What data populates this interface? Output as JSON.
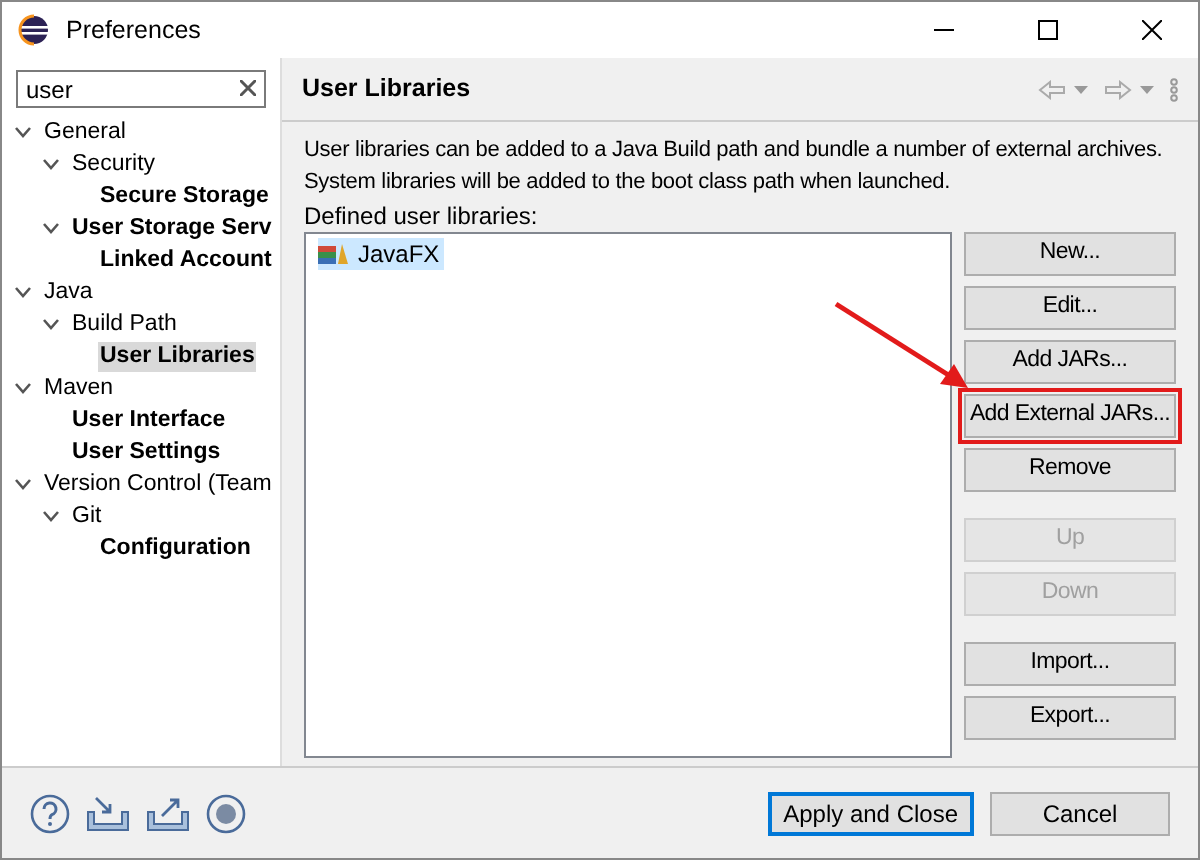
{
  "window": {
    "title": "Preferences"
  },
  "filter": {
    "value": "user"
  },
  "tree": [
    {
      "label": "General",
      "match": false,
      "expanded": true,
      "selected": false,
      "children": [
        {
          "label": "Security",
          "match": false,
          "expanded": true,
          "selected": false,
          "children": [
            {
              "label": "Secure Storage",
              "match": true,
              "selected": false
            }
          ]
        },
        {
          "label": "User Storage Serv",
          "match": true,
          "expanded": true,
          "selected": false,
          "children": [
            {
              "label": "Linked Account",
              "match": true,
              "selected": false
            }
          ]
        }
      ]
    },
    {
      "label": "Java",
      "match": false,
      "expanded": true,
      "selected": false,
      "children": [
        {
          "label": "Build Path",
          "match": false,
          "expanded": true,
          "selected": false,
          "children": [
            {
              "label": "User Libraries",
              "match": true,
              "selected": true
            }
          ]
        }
      ]
    },
    {
      "label": "Maven",
      "match": false,
      "expanded": true,
      "selected": false,
      "children": [
        {
          "label": "User Interface",
          "match": true,
          "selected": false
        },
        {
          "label": "User Settings",
          "match": true,
          "selected": false
        }
      ]
    },
    {
      "label": "Version Control (Team",
      "match": false,
      "expanded": true,
      "selected": false,
      "children": [
        {
          "label": "Git",
          "match": false,
          "expanded": true,
          "selected": false,
          "children": [
            {
              "label": "Configuration",
              "match": true,
              "selected": false
            }
          ]
        }
      ]
    }
  ],
  "page": {
    "title": "User Libraries",
    "description": [
      "User libraries can be added to a Java Build path and bundle a number of external archives.",
      "System libraries will be added to the boot class path when launched."
    ],
    "list_label": "Defined user libraries:",
    "libraries": [
      {
        "label": "JavaFX",
        "selected": true
      }
    ],
    "button_groups": [
      [
        {
          "label": "New...",
          "disabled": false,
          "highlighted": false
        },
        {
          "label": "Edit...",
          "disabled": false,
          "highlighted": false
        },
        {
          "label": "Add JARs...",
          "disabled": false,
          "highlighted": false
        },
        {
          "label": "Add External JARs...",
          "disabled": false,
          "highlighted": true
        },
        {
          "label": "Remove",
          "disabled": false,
          "highlighted": false
        }
      ],
      [
        {
          "label": "Up",
          "disabled": true,
          "highlighted": false
        },
        {
          "label": "Down",
          "disabled": true,
          "highlighted": false
        }
      ],
      [
        {
          "label": "Import...",
          "disabled": false,
          "highlighted": false
        },
        {
          "label": "Export...",
          "disabled": false,
          "highlighted": false
        }
      ]
    ]
  },
  "footer": {
    "buttons": [
      {
        "label": "Apply and Close",
        "default": true
      },
      {
        "label": "Cancel",
        "default": false
      }
    ]
  }
}
